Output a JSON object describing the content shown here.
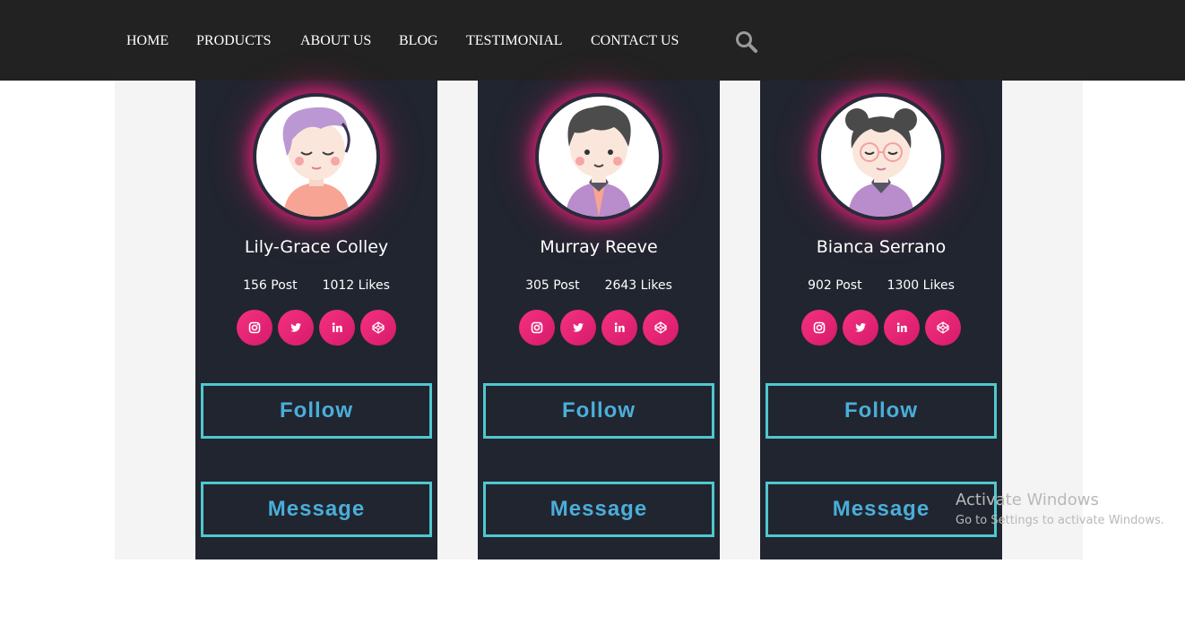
{
  "nav": {
    "items": [
      {
        "label": "HOME"
      },
      {
        "label": "PRODUCTS"
      },
      {
        "label": "ABOUT US"
      },
      {
        "label": "BLOG"
      },
      {
        "label": "TESTIMONIAL"
      },
      {
        "label": "CONTACT US"
      }
    ],
    "search_icon": "search-icon"
  },
  "cards": [
    {
      "name": "Lily-Grace Colley",
      "posts": "156",
      "posts_label": "Post",
      "likes": "1012",
      "likes_label": "Likes",
      "avatar": "girl-avatar-purple-hair",
      "follow_label": "Follow",
      "message_label": "Message"
    },
    {
      "name": "Murray Reeve",
      "posts": "305",
      "posts_label": "Post",
      "likes": "2643",
      "likes_label": "Likes",
      "avatar": "boy-avatar-curly-hair",
      "follow_label": "Follow",
      "message_label": "Message"
    },
    {
      "name": "Bianca Serrano",
      "posts": "902",
      "posts_label": "Post",
      "likes": "1300",
      "likes_label": "Likes",
      "avatar": "girl-avatar-glasses-buns",
      "follow_label": "Follow",
      "message_label": "Message"
    }
  ],
  "social_icons": [
    "instagram-icon",
    "twitter-icon",
    "linkedin-icon",
    "codepen-icon"
  ],
  "colors": {
    "navbar": "#222222",
    "card": "#212530",
    "accent_pink": "#e91e78",
    "button_border": "#4fc8d0",
    "button_text": "#4aaed9"
  },
  "os_watermark": {
    "title": "Activate Windows",
    "subtitle": "Go to Settings to activate Windows."
  }
}
